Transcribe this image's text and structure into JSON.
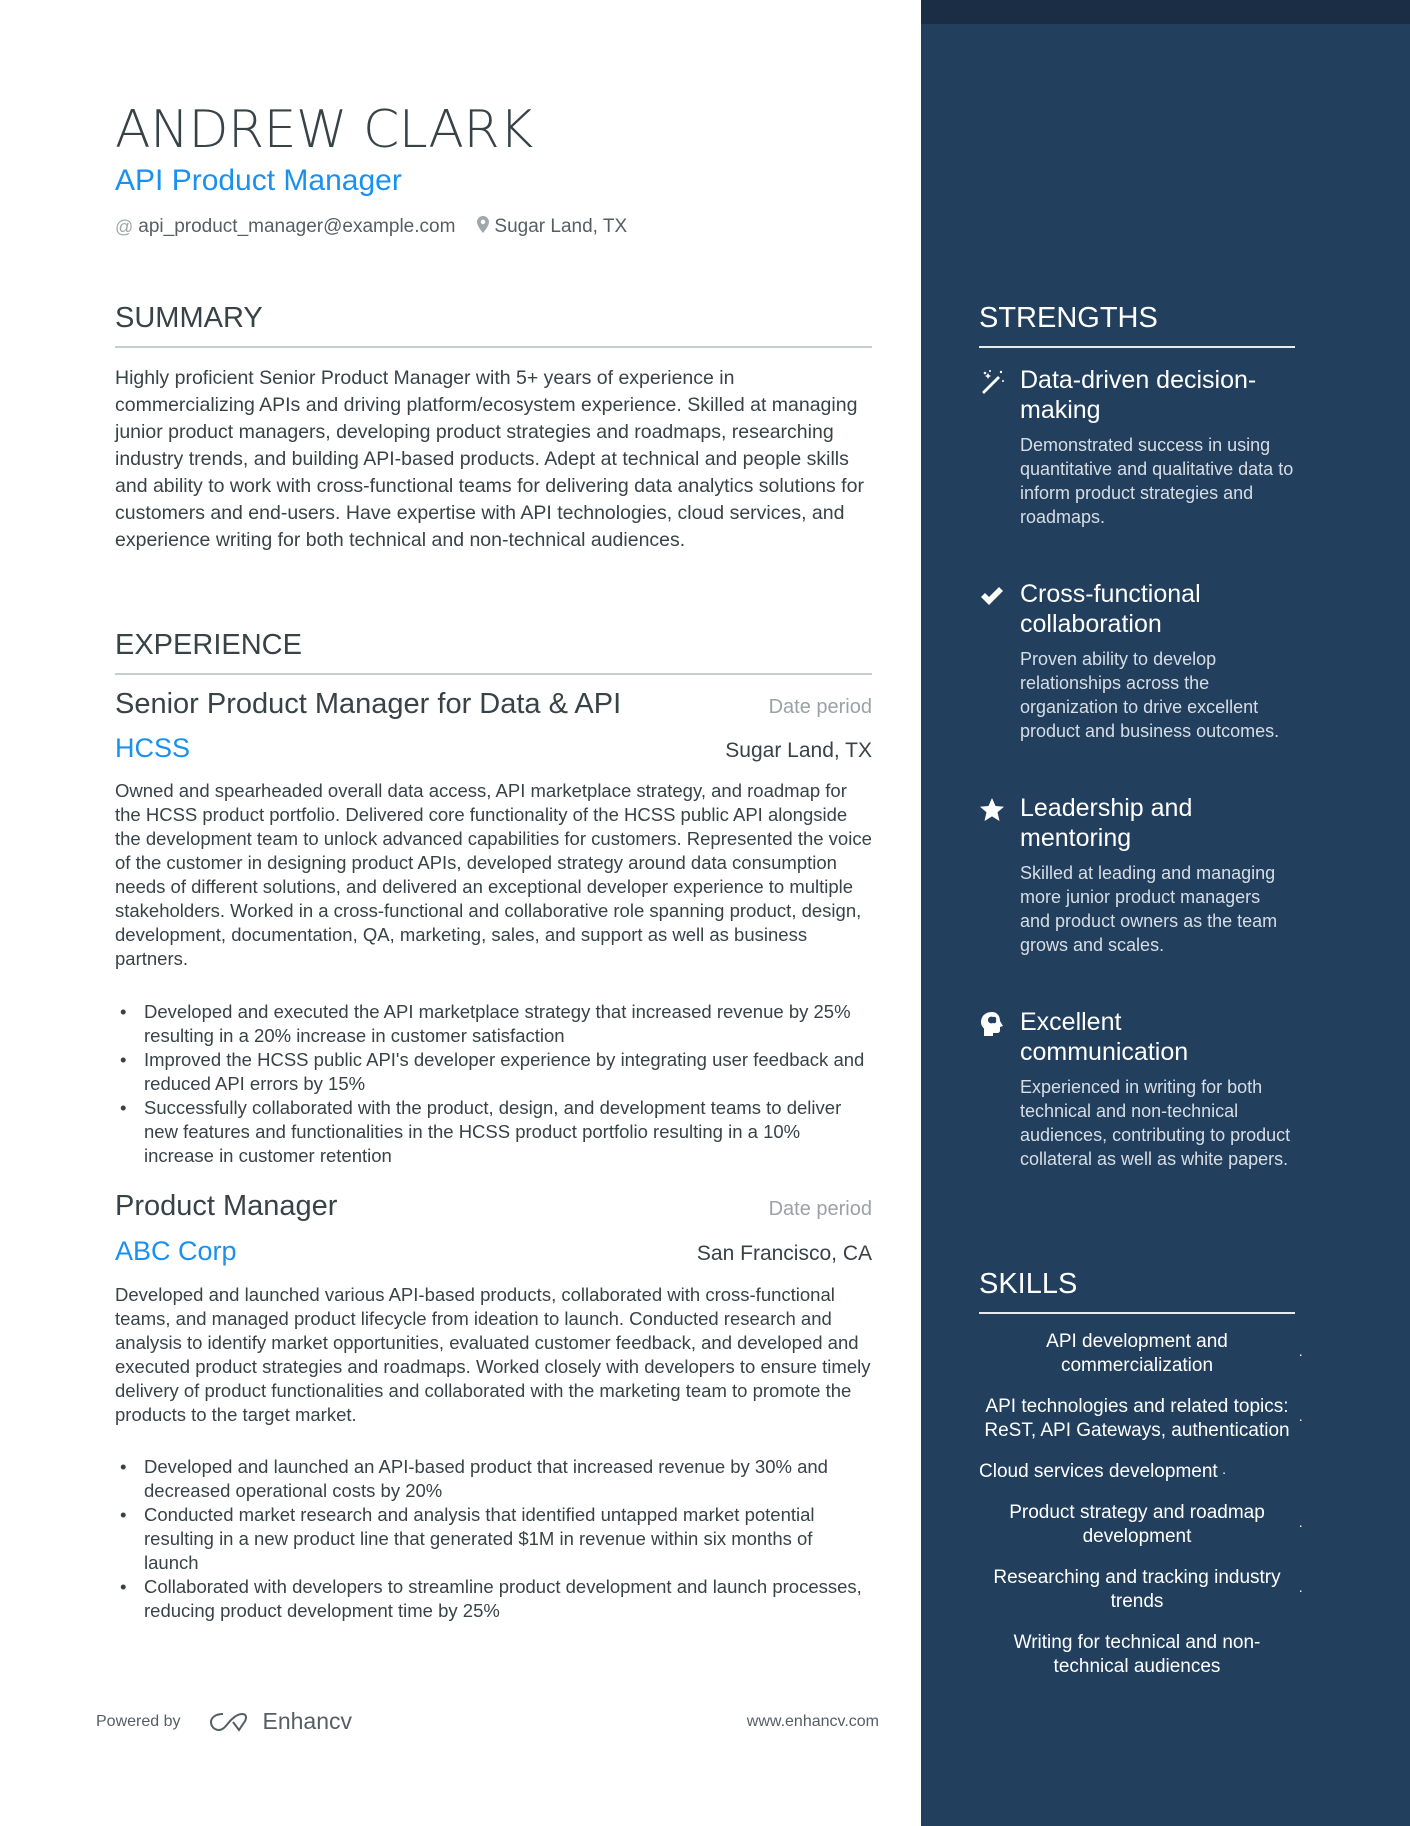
{
  "header": {
    "name": "ANDREW CLARK",
    "title": "API Product Manager",
    "email": "api_product_manager@example.com",
    "location": "Sugar Land, TX",
    "email_icon": "at-icon",
    "location_icon": "map-pin-icon"
  },
  "summary": {
    "heading": "SUMMARY",
    "text": "Highly proficient Senior Product Manager with 5+ years of experience in commercializing APIs and driving platform/ecosystem experience. Skilled at managing junior product managers, developing product strategies and roadmaps, researching industry trends, and building API-based products. Adept at technical and people skills and ability to work with cross-functional teams for delivering data analytics solutions for customers and end-users. Have expertise with API technologies, cloud services, and experience writing for both technical and non-technical audiences."
  },
  "experience": {
    "heading": "EXPERIENCE",
    "jobs": [
      {
        "title": "Senior Product Manager for Data & API",
        "date": "Date period",
        "company": "HCSS",
        "location": "Sugar Land, TX",
        "description": "Owned and spearheaded overall data access, API marketplace strategy, and roadmap for the HCSS product portfolio. Delivered core functionality of the HCSS public API alongside the development team to unlock advanced capabilities for customers. Represented the voice of the customer in designing product APIs, developed strategy around data consumption needs of different solutions, and delivered an exceptional developer experience to multiple stakeholders. Worked in a cross-functional and collaborative role spanning product, design, development, documentation, QA, marketing, sales, and support as well as business partners.",
        "bullets": [
          "Developed and executed the API marketplace strategy that increased revenue by 25% resulting in a 20% increase in customer satisfaction",
          "Improved the HCSS public API's developer experience by integrating user feedback and reduced API errors by 15%",
          "Successfully collaborated with the product, design, and development teams to deliver new features and functionalities in the HCSS product portfolio resulting in a 10% increase in customer retention"
        ]
      },
      {
        "title": "Product Manager",
        "date": "Date period",
        "company": "ABC Corp",
        "location": "San Francisco, CA",
        "description": "Developed and launched various API-based products, collaborated with cross-functional teams, and managed product lifecycle from ideation to launch. Conducted research and analysis to identify market opportunities, evaluated customer feedback, and developed and executed product strategies and roadmaps. Worked closely with developers to ensure timely delivery of product functionalities and collaborated with the marketing team to promote the products to the target market.",
        "bullets": [
          "Developed and launched an API-based product that increased revenue by 30% and decreased operational costs by 20%",
          "Conducted market research and analysis that identified untapped market potential resulting in a new product line that generated $1M in revenue within six months of launch",
          "Collaborated with developers to streamline product development and launch processes, reducing product development time by 25%"
        ]
      }
    ]
  },
  "strengths": {
    "heading": "STRENGTHS",
    "items": [
      {
        "icon": "magic-wand-icon",
        "title": "Data-driven decision-making",
        "description": "Demonstrated success in using quantitative and qualitative data to inform product strategies and roadmaps."
      },
      {
        "icon": "checkmark-icon",
        "title": "Cross-functional collaboration",
        "description": "Proven ability to develop relationships across the organization to drive excellent product and business outcomes."
      },
      {
        "icon": "star-icon",
        "title": "Leadership and mentoring",
        "description": "Skilled at leading and managing more junior product managers and product owners as the team grows and scales."
      },
      {
        "icon": "head-brain-icon",
        "title": "Excellent communication",
        "description": "Experienced in writing for both technical and non-technical audiences, contributing to product collateral as well as white papers."
      }
    ]
  },
  "skills": {
    "heading": "SKILLS",
    "separator": "·",
    "items": [
      "API development and commercialization",
      "API technologies and related topics: ReST, API Gateways, authentication",
      "Cloud services development",
      "Product strategy and roadmap development",
      "Researching and tracking industry trends",
      "Writing for technical and non-technical audiences"
    ]
  },
  "footer": {
    "powered_by": "Powered by",
    "brand": "Enhancv",
    "url": "www.enhancv.com"
  },
  "colors": {
    "accent": "#1a91f0",
    "sidebar": "#22405d",
    "sidebar_top": "#1a2d45",
    "text": "#384347"
  }
}
